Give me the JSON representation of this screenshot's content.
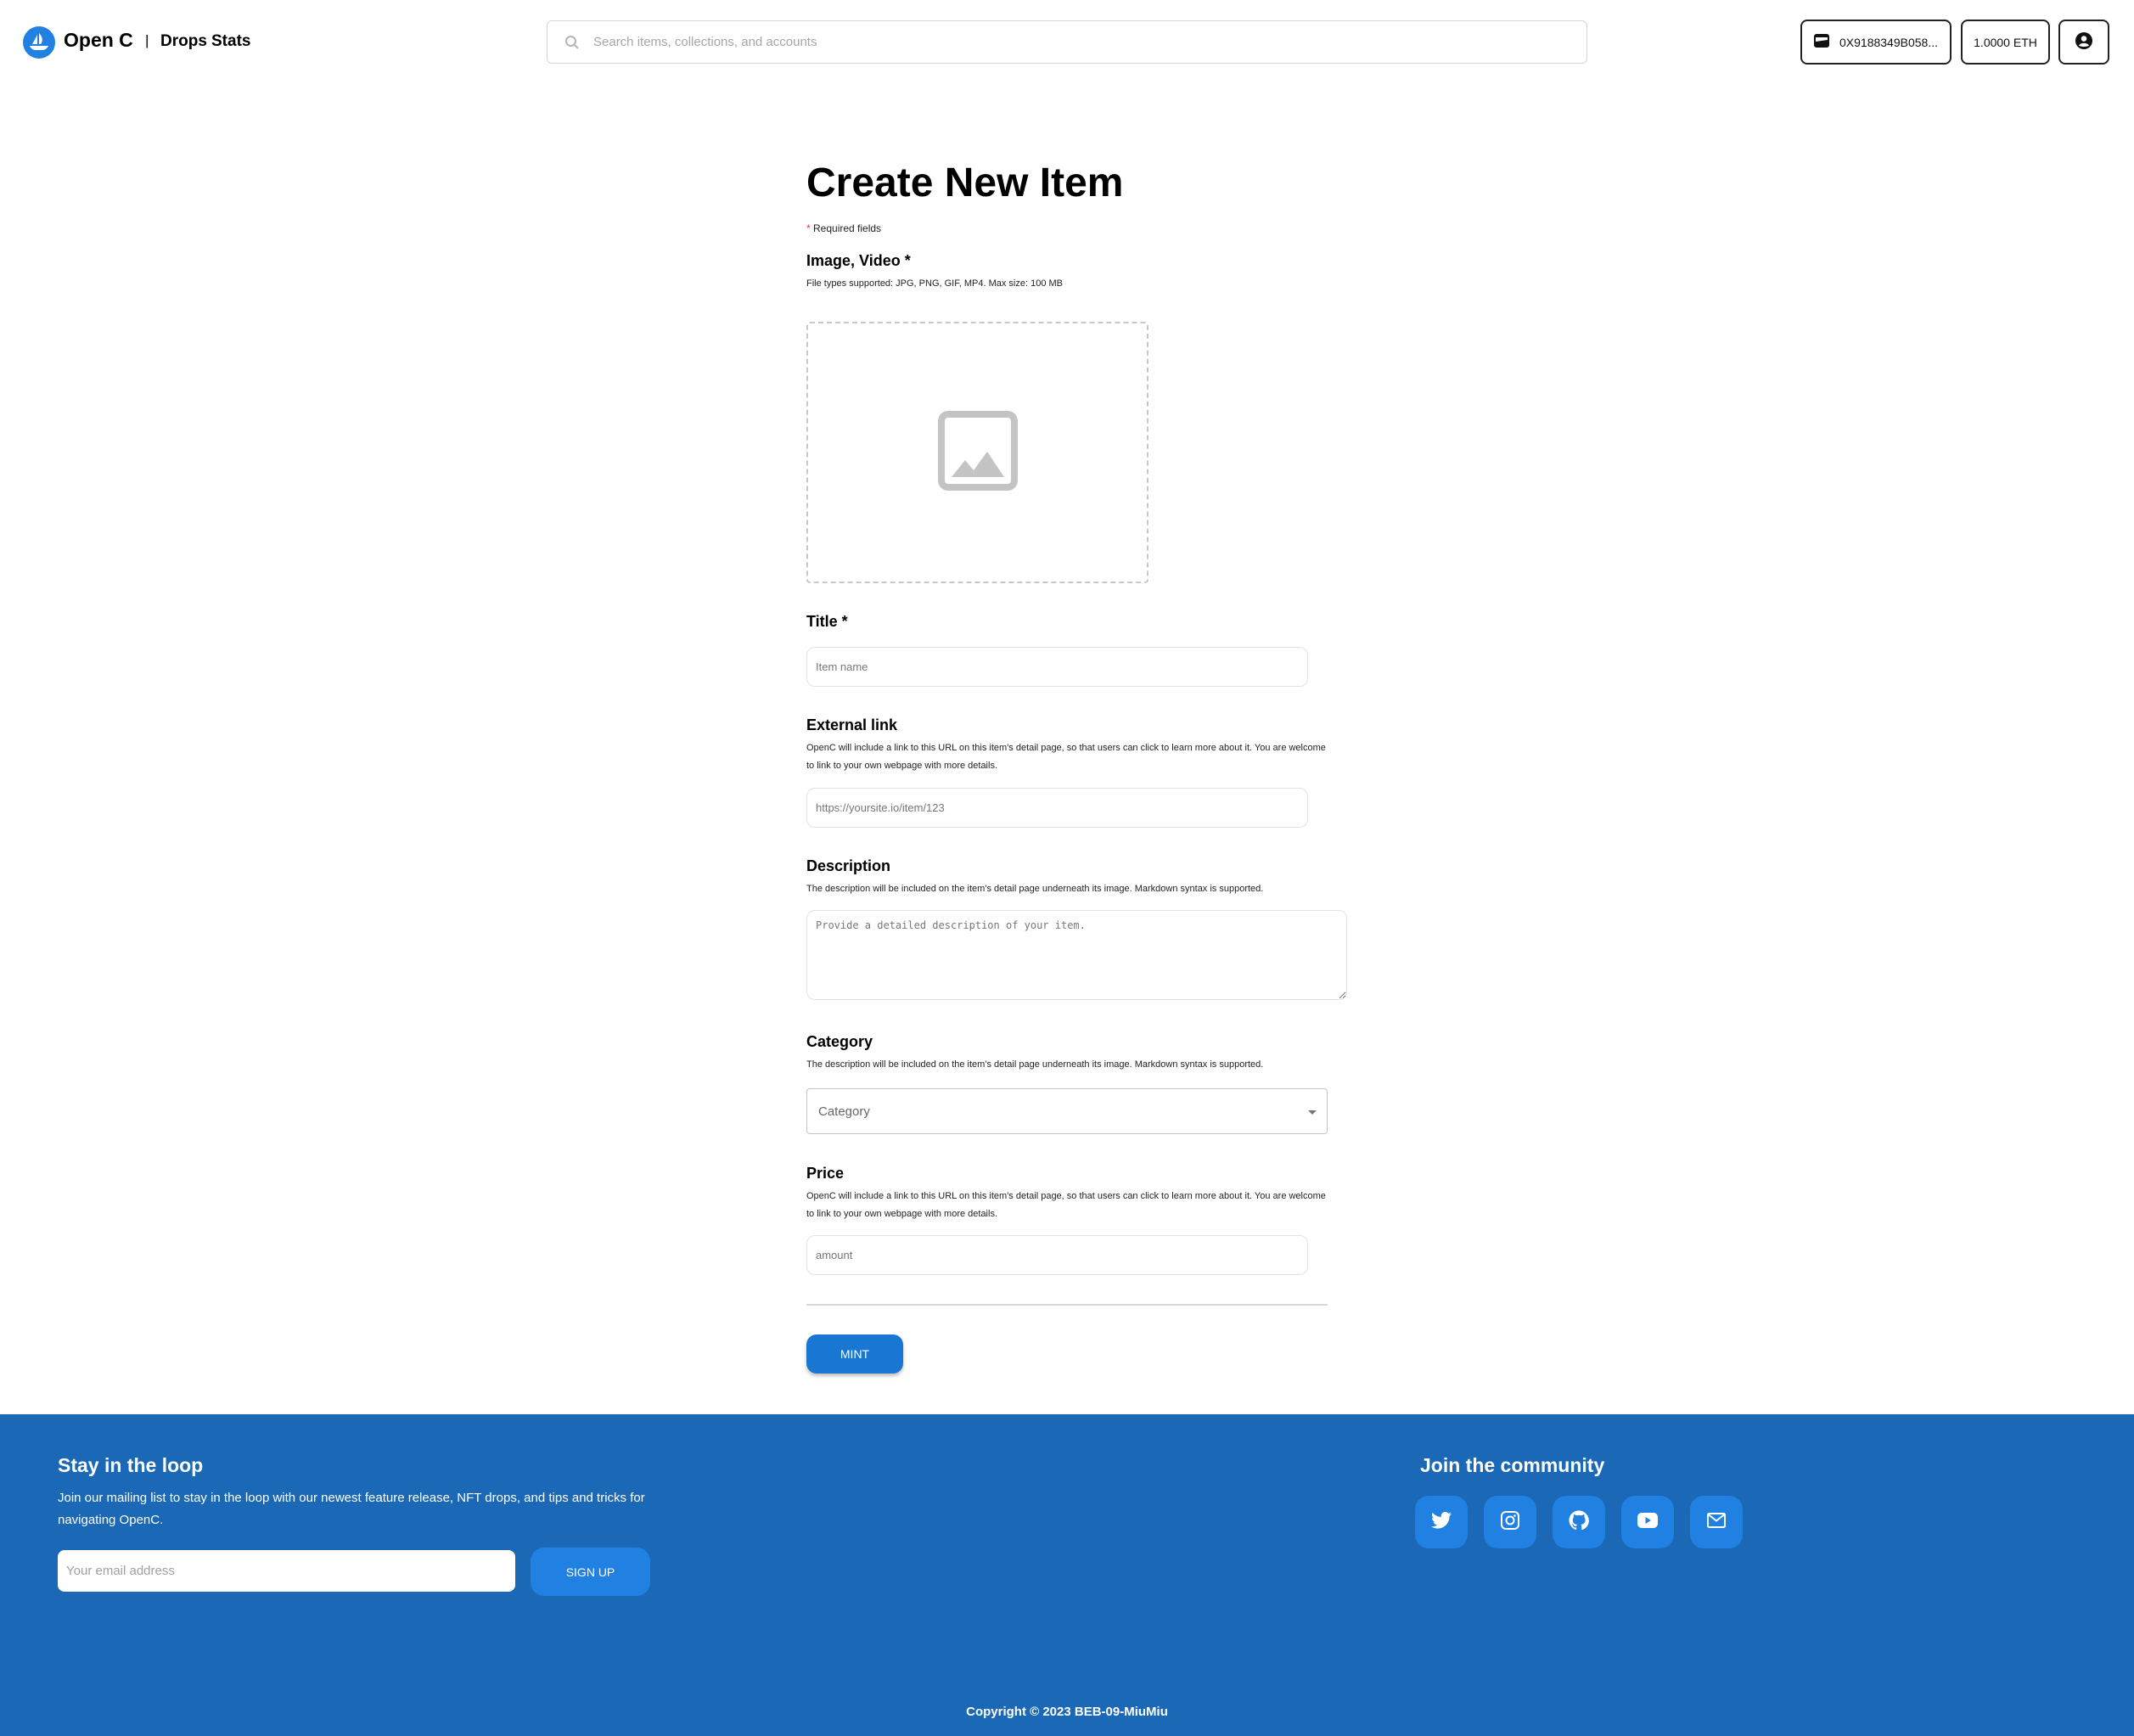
{
  "header": {
    "brand": "Open C",
    "separator": "|",
    "nav": [
      {
        "label": "Drops"
      },
      {
        "label": "Stats"
      }
    ],
    "search": {
      "placeholder": "Search items, collections, and accounts",
      "value": ""
    },
    "wallet_address": "0X9188349B058...",
    "balance": "1.0000 ETH"
  },
  "form": {
    "title": "Create New Item",
    "required_star": "*",
    "required_note": " Required fields",
    "media": {
      "label": "Image, Video *",
      "help": "File types supported: JPG, PNG, GIF, MP4. Max size: 100 MB"
    },
    "title_field": {
      "label": "Title *",
      "placeholder": "Item name",
      "value": ""
    },
    "external_link": {
      "label": "External link",
      "help": "OpenC will include a link to this URL on this item's detail page, so that users can click to learn more about it. You are welcome to link to your own webpage with more details.",
      "placeholder": "https://yoursite.io/item/123",
      "value": ""
    },
    "description": {
      "label": "Description",
      "help": "The description will be included on the item's detail page underneath its image. Markdown syntax is supported.",
      "placeholder": "Provide a detailed description of your item.",
      "value": ""
    },
    "category": {
      "label": "Category",
      "help": "The description will be included on the item's detail page underneath its image. Markdown syntax is supported.",
      "selected": "Category"
    },
    "price": {
      "label": "Price",
      "help": "OpenC will include a link to this URL on this item's detail page, so that users can click to learn more about it. You are welcome to link to your own webpage with more details.",
      "placeholder": "amount",
      "value": ""
    },
    "submit_label": "MINT"
  },
  "footer": {
    "newsletter_title": "Stay in the loop",
    "newsletter_text": "Join our mailing list to stay in the loop with our newest feature release, NFT drops, and tips and tricks for navigating OpenC.",
    "email_placeholder": "Your email address",
    "signup_label": "SIGN UP",
    "community_title": "Join the community",
    "socials": [
      "twitter-icon",
      "instagram-icon",
      "github-icon",
      "youtube-icon",
      "email-icon"
    ],
    "copyright": "Copyright © 2023 BEB-09-MiuMiu"
  },
  "colors": {
    "brand_blue": "#2081e2",
    "primary_button": "#1976d2",
    "footer_bg": "#1b68b7",
    "required_star": "#e53935"
  }
}
